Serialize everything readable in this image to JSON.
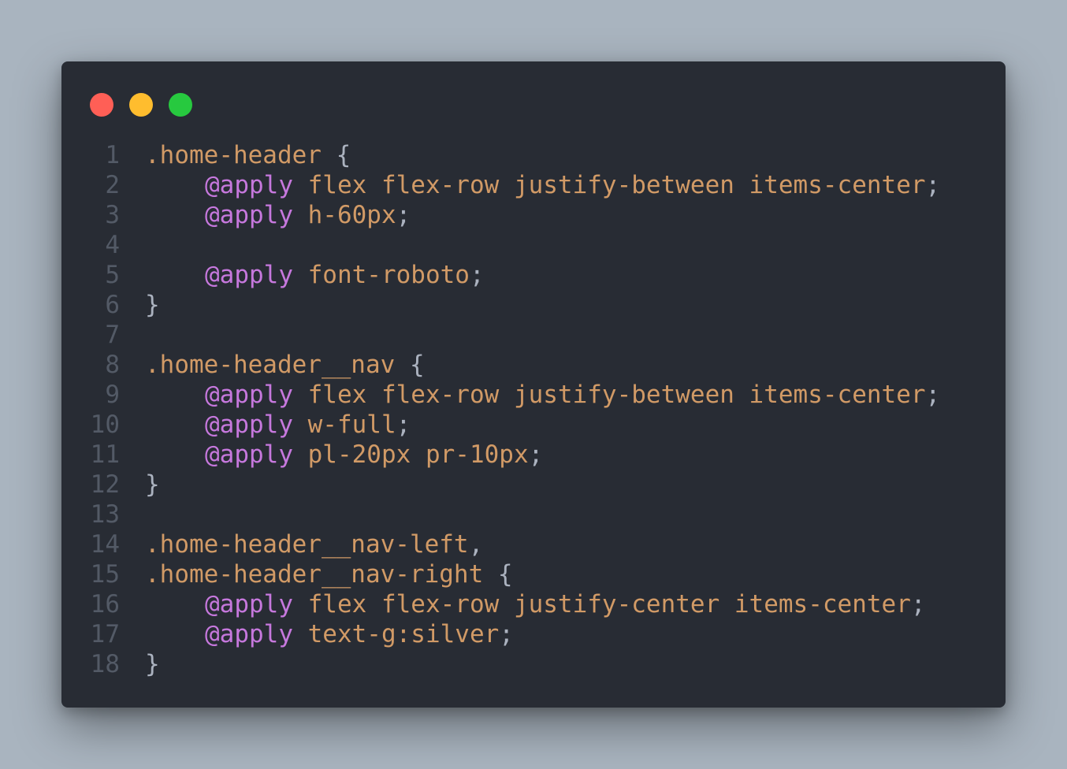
{
  "window_controls": {
    "close_color": "#ff5f56",
    "minimize_color": "#ffbd2e",
    "maximize_color": "#27c93f"
  },
  "colors": {
    "background": "#a9b4bf",
    "editor": "#282c34",
    "selector": "#d19a66",
    "keyword": "#c678dd",
    "value": "#d19a66",
    "punctuation": "#abb2bf",
    "line_number": "#535a66"
  },
  "code": {
    "lines": [
      {
        "n": "1",
        "indent": false,
        "sel": ".home-header",
        "kw": "",
        "val": "",
        "punc": " {"
      },
      {
        "n": "2",
        "indent": true,
        "sel": "",
        "kw": "@apply",
        "val": " flex flex-row justify-between items-center",
        "punc": ";"
      },
      {
        "n": "3",
        "indent": true,
        "sel": "",
        "kw": "@apply",
        "val": " h-60px",
        "punc": ";"
      },
      {
        "n": "4",
        "indent": false,
        "sel": "",
        "kw": "",
        "val": "",
        "punc": ""
      },
      {
        "n": "5",
        "indent": true,
        "sel": "",
        "kw": "@apply",
        "val": " font-roboto",
        "punc": ";"
      },
      {
        "n": "6",
        "indent": false,
        "sel": "",
        "kw": "",
        "val": "",
        "punc": "}"
      },
      {
        "n": "7",
        "indent": false,
        "sel": "",
        "kw": "",
        "val": "",
        "punc": ""
      },
      {
        "n": "8",
        "indent": false,
        "sel": ".home-header__nav",
        "kw": "",
        "val": "",
        "punc": " {"
      },
      {
        "n": "9",
        "indent": true,
        "sel": "",
        "kw": "@apply",
        "val": " flex flex-row justify-between items-center",
        "punc": ";"
      },
      {
        "n": "10",
        "indent": true,
        "sel": "",
        "kw": "@apply",
        "val": " w-full",
        "punc": ";"
      },
      {
        "n": "11",
        "indent": true,
        "sel": "",
        "kw": "@apply",
        "val": " pl-20px pr-10px",
        "punc": ";"
      },
      {
        "n": "12",
        "indent": false,
        "sel": "",
        "kw": "",
        "val": "",
        "punc": "}"
      },
      {
        "n": "13",
        "indent": false,
        "sel": "",
        "kw": "",
        "val": "",
        "punc": ""
      },
      {
        "n": "14",
        "indent": false,
        "sel": ".home-header__nav-left",
        "kw": "",
        "val": "",
        "punc": ","
      },
      {
        "n": "15",
        "indent": false,
        "sel": ".home-header__nav-right",
        "kw": "",
        "val": "",
        "punc": " {"
      },
      {
        "n": "16",
        "indent": true,
        "sel": "",
        "kw": "@apply",
        "val": " flex flex-row justify-center items-center",
        "punc": ";"
      },
      {
        "n": "17",
        "indent": true,
        "sel": "",
        "kw": "@apply",
        "val": " text-g:silver",
        "punc": ";"
      },
      {
        "n": "18",
        "indent": false,
        "sel": "",
        "kw": "",
        "val": "",
        "punc": "}"
      }
    ]
  }
}
